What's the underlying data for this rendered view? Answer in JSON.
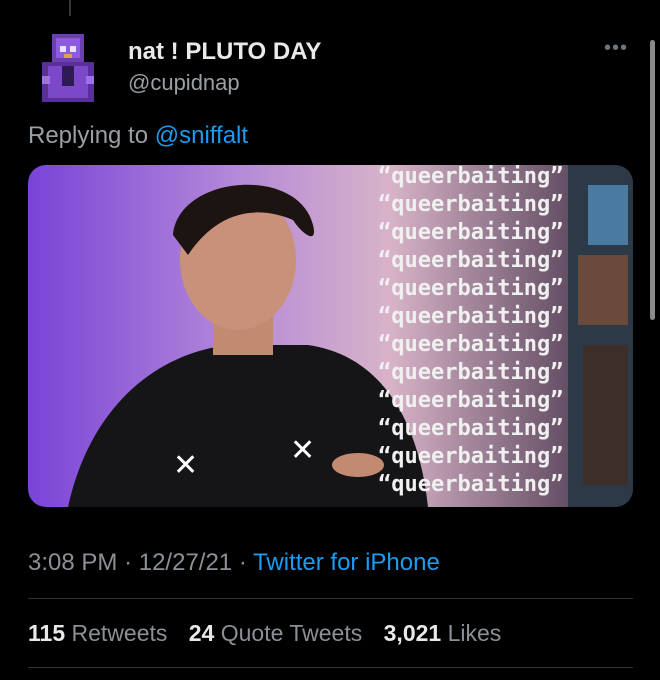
{
  "tweet": {
    "display_name": "nat ! PLUTO DAY",
    "handle": "@cupidnap",
    "replying_prefix": "Replying to",
    "replying_to": "@sniffalt",
    "time": "3:08 PM",
    "date": "12/27/21",
    "source": "Twitter for iPhone",
    "sep": "·"
  },
  "media": {
    "overlay_lines": [
      "“queerbaiting”",
      "“queerbaiting”",
      "“queerbaiting”",
      "“queerbaiting”",
      "“queerbaiting”",
      "“queerbaiting”",
      "“queerbaiting”",
      "“queerbaiting”",
      "“queerbaiting”",
      "“queerbaiting”",
      "“queerbaiting”",
      "“queerbaiting”"
    ]
  },
  "stats": {
    "retweets_count": "115",
    "retweets_label": "Retweets",
    "quotes_count": "24",
    "quotes_label": "Quote Tweets",
    "likes_count": "3,021",
    "likes_label": "Likes"
  },
  "icons": {
    "more": "more-icon",
    "avatar": "pixel-avatar"
  },
  "colors": {
    "link": "#1d9bf0",
    "background": "#000000",
    "secondary": "#8b9096"
  }
}
